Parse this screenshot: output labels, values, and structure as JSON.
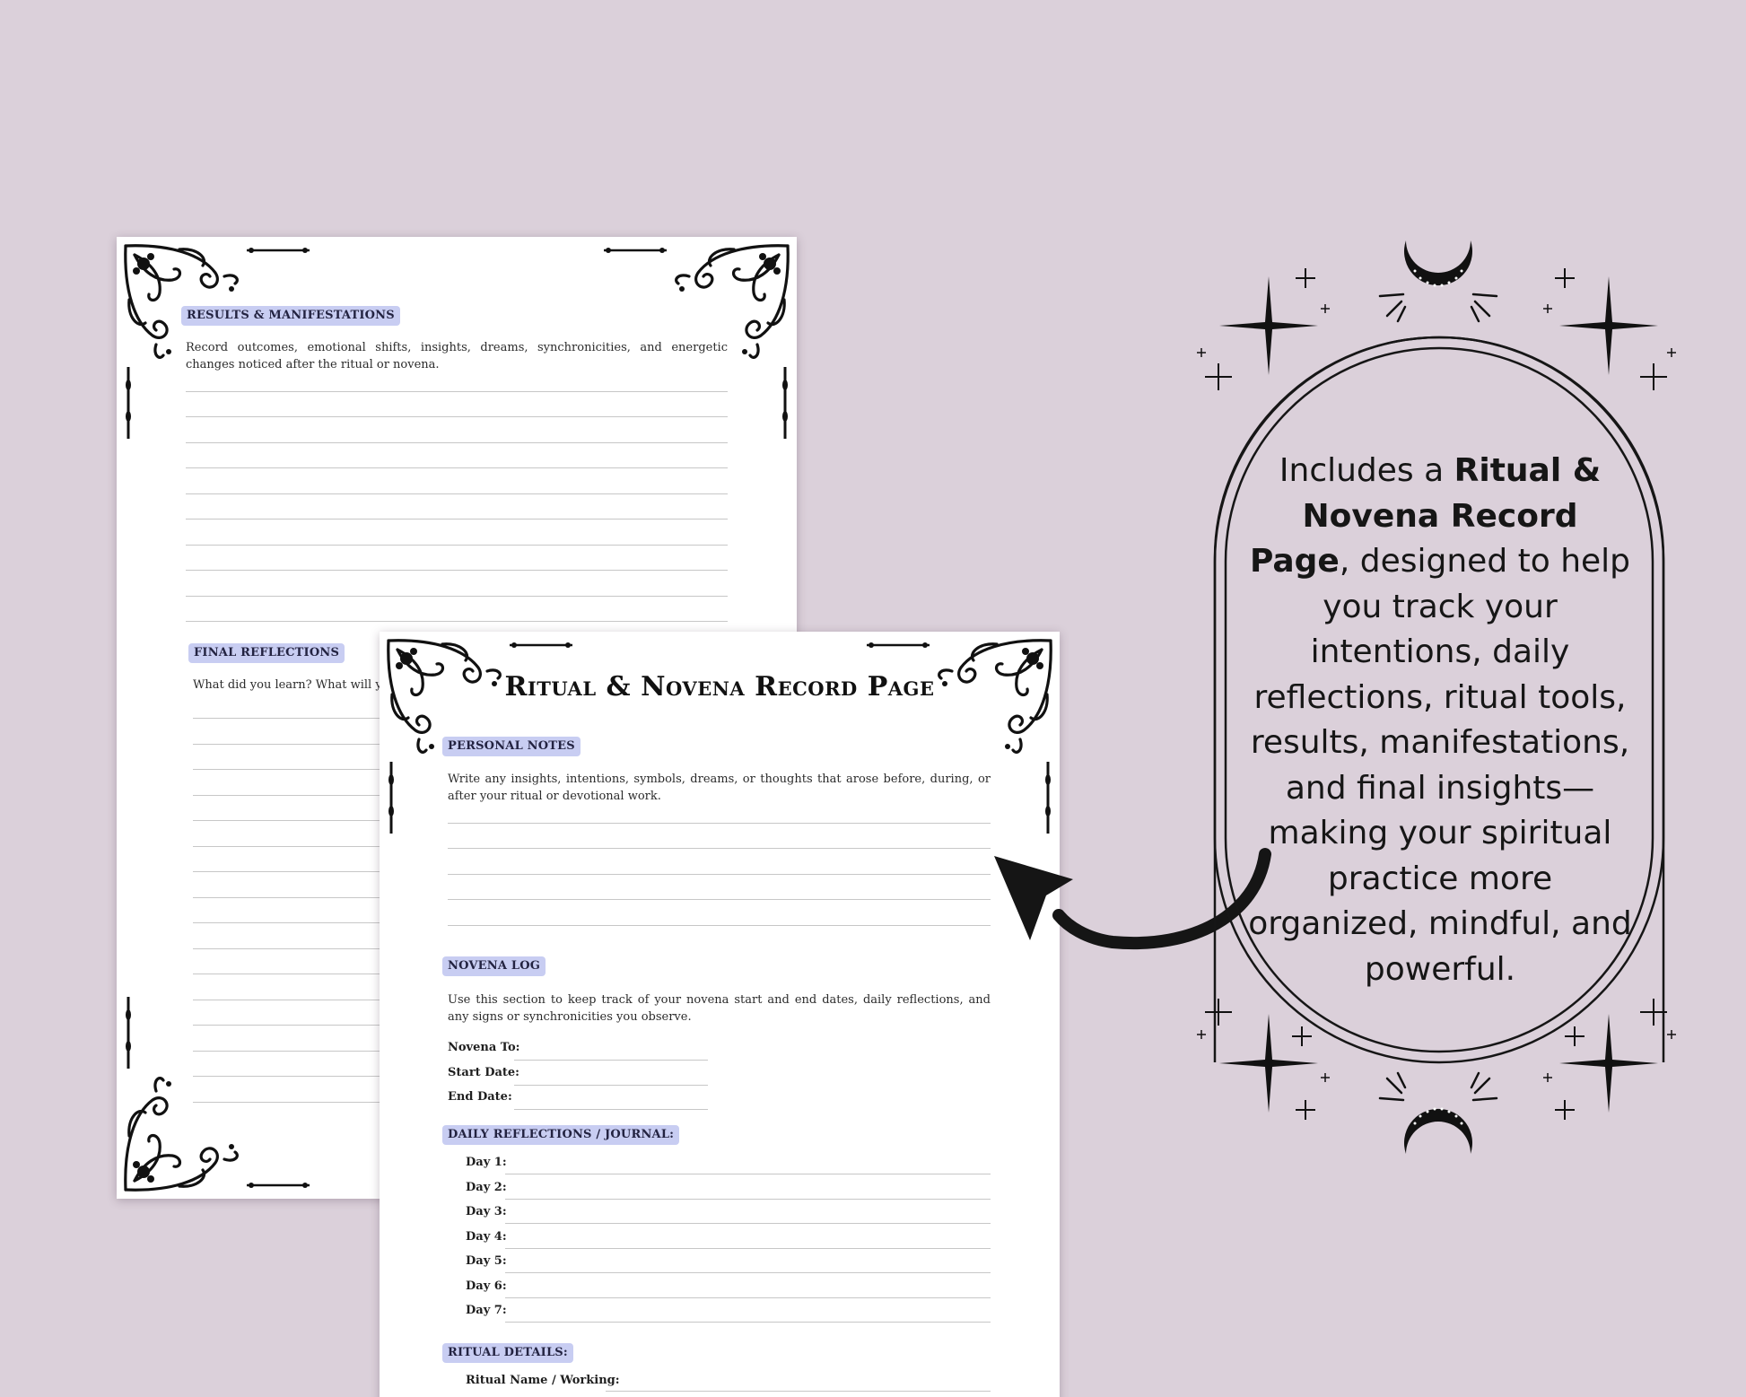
{
  "colors": {
    "background": "#dbd0da",
    "tag_highlight": "#c8cdf2",
    "ink": "#111111"
  },
  "back_page": {
    "results": {
      "heading": "RESULTS & MANIFESTATIONS",
      "description": "Record outcomes, emotional shifts, insights, dreams, synchronicities, and energetic changes noticed after the ritual or novena."
    },
    "final_reflections": {
      "heading": "FINAL REFLECTIONS",
      "description": "What did you learn? What will yo"
    }
  },
  "front_page": {
    "title": "Ritual & Novena Record Page",
    "personal_notes": {
      "heading": "PERSONAL NOTES",
      "description": "Write any insights, intentions, symbols, dreams, or thoughts that arose before, during, or after your ritual or devotional work."
    },
    "novena_log": {
      "heading": "NOVENA LOG",
      "description": "Use this section to keep track of your novena start and end dates, daily reflections, and any signs or synchronicities you observe.",
      "fields": [
        "Novena To:",
        "Start Date:",
        "End Date:"
      ]
    },
    "daily_reflections": {
      "heading": "DAILY REFLECTIONS / JOURNAL:",
      "days": [
        "Day 1:",
        "Day 2:",
        "Day 3:",
        "Day 4:",
        "Day 5:",
        "Day 6:",
        "Day 7:"
      ]
    },
    "ritual_details": {
      "heading": "RITUAL DETAILS:",
      "fields": [
        "Ritual Name / Working:"
      ]
    }
  },
  "callout": {
    "text_before": "Includes a ",
    "text_bold": "Ritual & Novena Record Page",
    "text_after": ", designed to help you track your intentions, daily reflections, ritual tools, results, manifestations, and final insights—making your spiritual practice more organized, mindful, and powerful.",
    "icons": [
      "crescent-moon-icon",
      "sparkle-star-icon",
      "arrow-icon"
    ]
  }
}
